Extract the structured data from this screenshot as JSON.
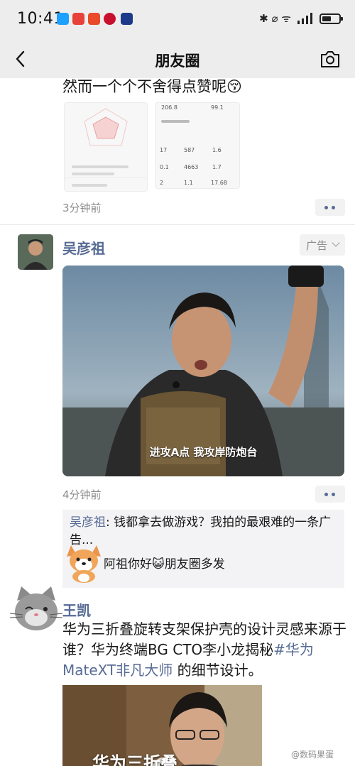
{
  "status": {
    "time": "10:41",
    "signal_glyphs": "✱ ⌀ ᯤ"
  },
  "nav": {
    "title": "朋友圈"
  },
  "post1": {
    "text_cut": "然而一个个不舍得点赞呢😚",
    "time": "3分钟前",
    "shot_values": [
      "206.8",
      "99.1",
      "17",
      "587",
      "1.6",
      "0.1",
      "4663",
      "1.7",
      "2",
      "1.1",
      "17.68"
    ]
  },
  "post2": {
    "author": "吴彦祖",
    "ad_label": "广告",
    "video_subtitle": "进攻A点 我攻岸防炮台",
    "time": "4分钟前",
    "comment_author": "吴彦祖",
    "comment_text": ": 钱都拿去做游戏？我拍的最艰难的一条广告...",
    "reply_text": "阿祖你好😺朋友圈多发"
  },
  "post3": {
    "author": "王凯",
    "text_before": "华为三折叠旋转支架保护壳的设计灵感来源于谁？华为终端BG CTO李小龙揭秘",
    "topic_link": "#华为MateXT非凡大师",
    "text_after": " 的细节设计。",
    "thumb_caption": "华为三折叠"
  },
  "watermark": "@数码果蛋",
  "colors": {
    "link": "#576b95",
    "bar_bg": "#ededed",
    "time_grey": "#8c8c8c"
  }
}
